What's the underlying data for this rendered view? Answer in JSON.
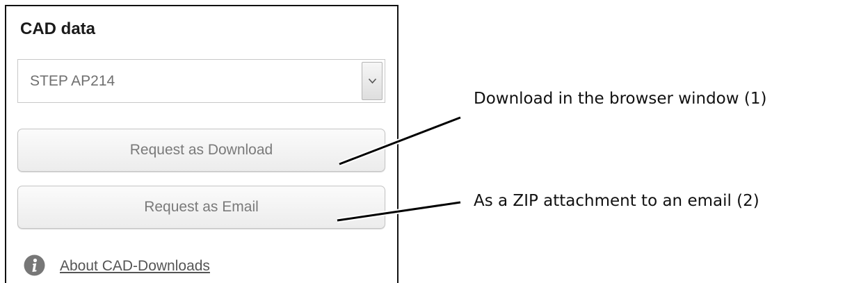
{
  "panel": {
    "title": "CAD data",
    "format_select": {
      "value": "STEP AP214"
    },
    "buttons": {
      "download_label": "Request as Download",
      "email_label": "Request as Email"
    },
    "about": {
      "icon": "info-icon",
      "link_text": "About CAD-Downloads"
    }
  },
  "callouts": {
    "download": "Download in the browser window (1)",
    "email": "As a ZIP attachment to an email (2)"
  },
  "colors": {
    "panel_border": "#111111",
    "button_text": "#7a7a7a",
    "info_icon": "#777777"
  }
}
